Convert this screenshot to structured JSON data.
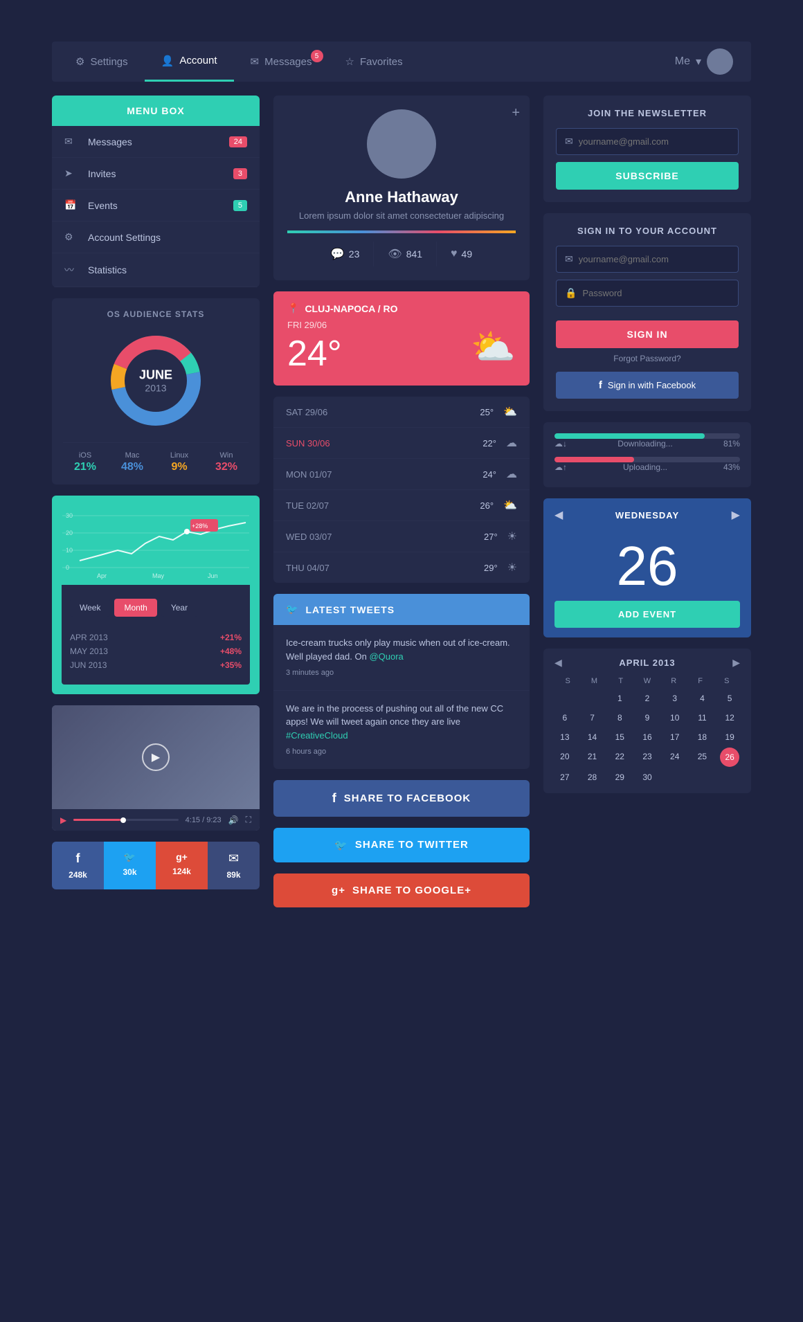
{
  "topnav": {
    "tabs": [
      {
        "label": "Settings",
        "icon": "⚙",
        "active": false
      },
      {
        "label": "Account",
        "icon": "👤",
        "active": true
      },
      {
        "label": "Messages",
        "icon": "✉",
        "active": false,
        "badge": "5"
      },
      {
        "label": "Favorites",
        "icon": "☆",
        "active": false
      }
    ],
    "user": "Me",
    "avatar": ""
  },
  "menubox": {
    "title": "MENU BOX",
    "items": [
      {
        "label": "Messages",
        "icon": "✉",
        "badge": "24",
        "badgeColor": "default"
      },
      {
        "label": "Invites",
        "icon": "➤",
        "badge": "3",
        "badgeColor": "red"
      },
      {
        "label": "Events",
        "icon": "📅",
        "badge": "5",
        "badgeColor": "teal"
      },
      {
        "label": "Account Settings",
        "icon": "⚙",
        "badge": "",
        "badgeColor": ""
      },
      {
        "label": "Statistics",
        "icon": "~",
        "badge": "",
        "badgeColor": ""
      }
    ]
  },
  "os_stats": {
    "title": "OS AUDIENCE STATS",
    "month": "JUNE",
    "year": "2013",
    "segments": [
      {
        "label": "iOS",
        "pct": "21%",
        "color": "#2fcfb3"
      },
      {
        "label": "Mac",
        "pct": "48%",
        "color": "#4a90d9"
      },
      {
        "label": "Linux",
        "pct": "9%",
        "color": "#f5a623"
      },
      {
        "label": "Win",
        "pct": "32%",
        "color": "#e84d6a"
      }
    ]
  },
  "chart": {
    "months": [
      "Apr",
      "May",
      "Jun"
    ],
    "tooltip": "+28%",
    "stats": [
      {
        "period": "APR 2013",
        "val": "+21%"
      },
      {
        "period": "MAY 2013",
        "val": "+48%"
      },
      {
        "period": "JUN 2013",
        "val": "+35%"
      }
    ],
    "buttons": [
      "Week",
      "Month",
      "Year"
    ],
    "active_btn": "Month"
  },
  "video": {
    "time": "4:15 / 9:23"
  },
  "social": {
    "items": [
      {
        "icon": "f",
        "count": "248k",
        "class": "s-fb"
      },
      {
        "icon": "t",
        "count": "30k",
        "class": "s-tw"
      },
      {
        "icon": "g+",
        "count": "124k",
        "class": "s-gp"
      },
      {
        "icon": "✉",
        "count": "89k",
        "class": "s-em"
      }
    ]
  },
  "profile": {
    "name": "Anne Hathaway",
    "bio": "Lorem ipsum dolor sit amet consectetuer adipiscing",
    "add_btn": "+",
    "stats": [
      {
        "icon": "💬",
        "val": "23"
      },
      {
        "icon": "👁",
        "val": "841"
      },
      {
        "icon": "♥",
        "val": "49"
      }
    ]
  },
  "weather": {
    "location": "CLUJ-NAPOCA / RO",
    "date": "FRI  29/06",
    "temp": "24°",
    "icon": "⛅",
    "forecast": [
      {
        "day": "SAT 29/06",
        "temp": "25°",
        "icon": "⛅",
        "sunday": false
      },
      {
        "day": "SUN 30/06",
        "temp": "22°",
        "icon": "☁",
        "sunday": true
      },
      {
        "day": "MON 01/07",
        "temp": "24°",
        "icon": "☁",
        "sunday": false
      },
      {
        "day": "TUE 02/07",
        "temp": "26°",
        "icon": "⛅",
        "sunday": false
      },
      {
        "day": "WED 03/07",
        "temp": "27°",
        "icon": "☀",
        "sunday": false
      },
      {
        "day": "THU 04/07",
        "temp": "29°",
        "icon": "☀",
        "sunday": false
      }
    ]
  },
  "tweets": {
    "header": "LATEST TWEETS",
    "items": [
      {
        "text": "Ice-cream trucks only play music when out of ice-cream. Well played dad. On ",
        "link": "@Quora",
        "time": "3 minutes ago"
      },
      {
        "text": "We are in the process of pushing out all of the new CC apps! We will tweet again once they are live ",
        "link": "#CreativeCloud",
        "time": "6 hours ago"
      }
    ]
  },
  "share": {
    "facebook": "SHARE TO FACEBOOK",
    "twitter": "SHARE TO TWITTER",
    "google": "SHARE TO GOOGLE+"
  },
  "newsletter": {
    "title": "JOIN THE NEWSLETTER",
    "email_placeholder": "yourname@gmail.com",
    "subscribe_label": "SUBSCRIBE"
  },
  "signin": {
    "title": "SIGN IN TO YOUR ACCOUNT",
    "email_placeholder": "yourname@gmail.com",
    "password_placeholder": "Password",
    "signin_label": "SIGN IN",
    "forgot_label": "Forgot Password?",
    "facebook_label": "Sign in with Facebook"
  },
  "progress": {
    "items": [
      {
        "label": "Downloading...",
        "pct": "81%",
        "width": "81",
        "color": "teal"
      },
      {
        "label": "Uploading...",
        "pct": "43%",
        "width": "43",
        "color": "pink"
      }
    ]
  },
  "cal_widget": {
    "day_name": "WEDNESDAY",
    "day_num": "26",
    "add_event": "ADD EVENT"
  },
  "small_cal": {
    "month": "APRIL 2013",
    "days_header": [
      "S",
      "M",
      "T",
      "W",
      "R",
      "F",
      "S"
    ],
    "days": [
      "",
      "",
      "1",
      "2",
      "3",
      "4",
      "5",
      "6",
      "7",
      "8",
      "9",
      "10",
      "11",
      "12",
      "13",
      "14",
      "15",
      "16",
      "17",
      "18",
      "19",
      "20",
      "21",
      "22",
      "23",
      "24",
      "25",
      "26",
      "27",
      "28",
      "29",
      "30",
      ""
    ]
  }
}
